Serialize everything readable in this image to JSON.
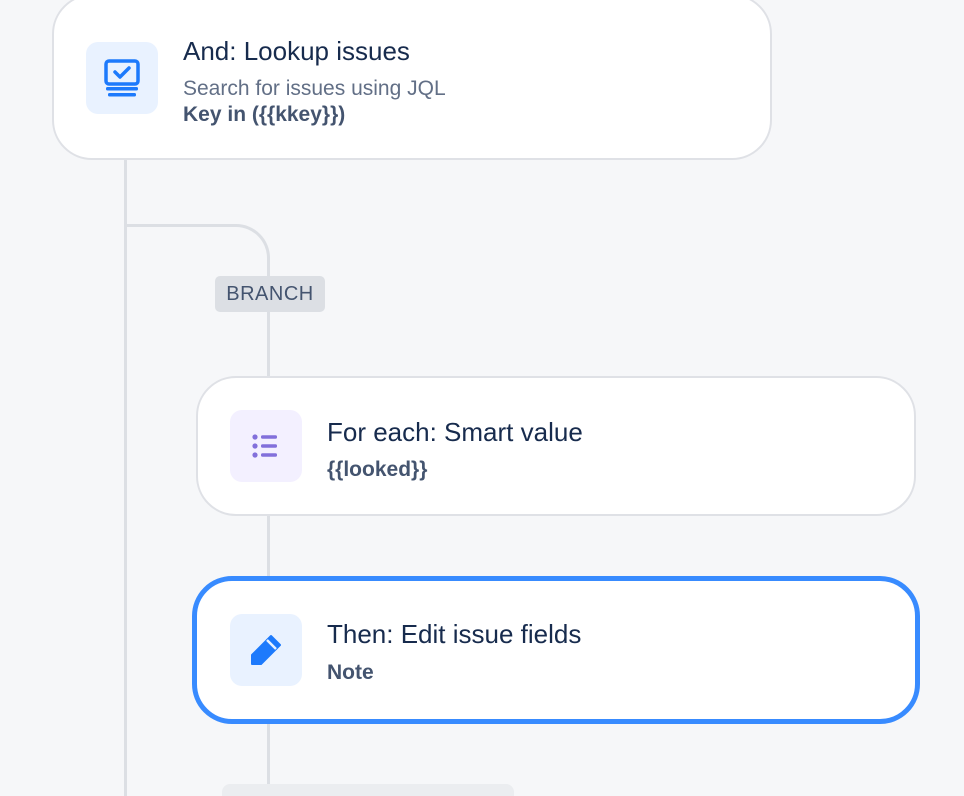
{
  "steps": {
    "lookup": {
      "title": "And: Lookup issues",
      "subtitle": "Search for issues using JQL",
      "detail": "Key in ({{kkey}})",
      "icon": "lookup-issues-icon"
    },
    "branch_label": "BRANCH",
    "for_each": {
      "title": "For each: Smart value",
      "detail": "{{looked}}",
      "icon": "list-icon"
    },
    "edit": {
      "title": "Then: Edit issue fields",
      "detail": "Note",
      "icon": "pencil-icon",
      "selected": true
    }
  },
  "colors": {
    "accent": "#388bff",
    "icon_blue": "#1d7afc",
    "icon_purple": "#8270db",
    "connector": "#dcdfe4"
  }
}
